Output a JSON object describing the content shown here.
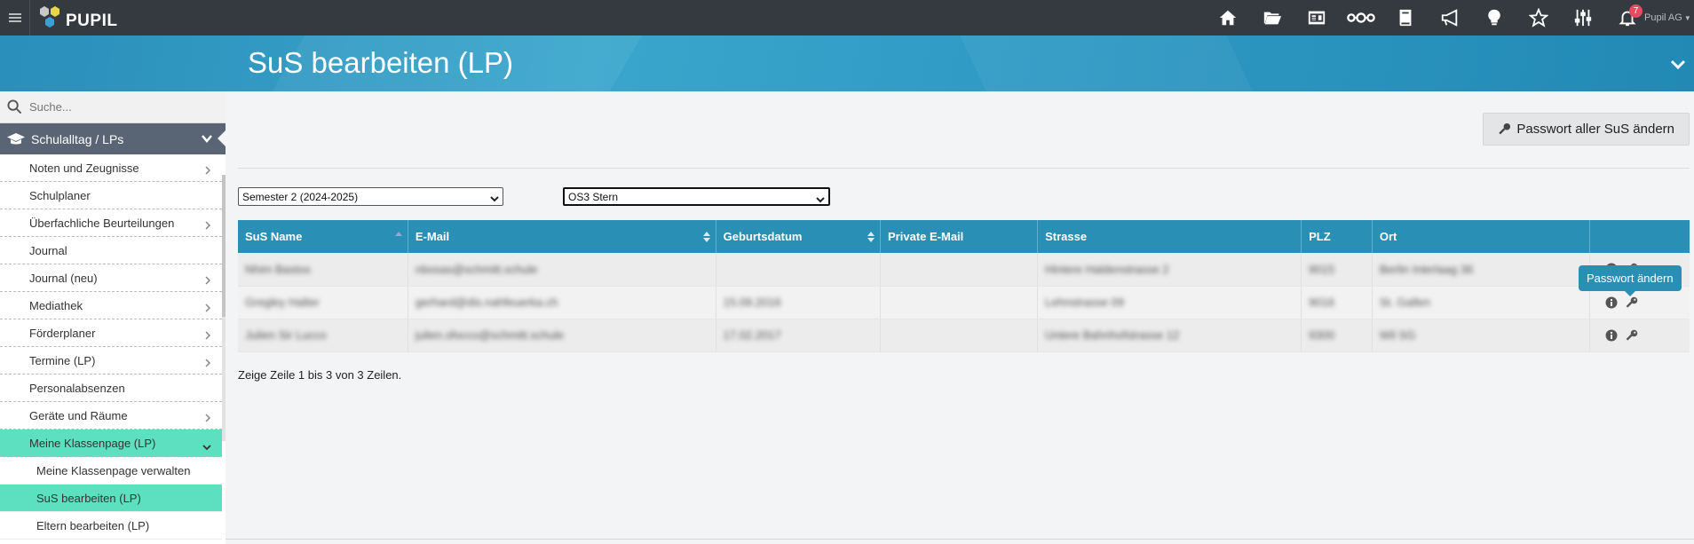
{
  "app": {
    "logo_text": "PUPIL",
    "user_name": "Pupil AG",
    "notification_count": "7",
    "top_icons": [
      "home-icon",
      "folder-icon",
      "id-card-icon",
      "network-icon",
      "book-icon",
      "megaphone-icon",
      "lightbulb-icon",
      "star-icon",
      "sliders-icon",
      "bell-icon"
    ]
  },
  "banner": {
    "title": "SuS bearbeiten (LP)"
  },
  "sidebar": {
    "search_placeholder": "Suche...",
    "section": "Schulalltag / LPs",
    "items": [
      {
        "label": "Noten und Zeugnisse",
        "has_children": true
      },
      {
        "label": "Schulplaner",
        "has_children": false
      },
      {
        "label": "Überfachliche Beurteilungen",
        "has_children": true
      },
      {
        "label": "Journal",
        "has_children": false
      },
      {
        "label": "Journal (neu)",
        "has_children": true
      },
      {
        "label": "Mediathek",
        "has_children": true
      },
      {
        "label": "Förderplaner",
        "has_children": true
      },
      {
        "label": "Termine (LP)",
        "has_children": true
      },
      {
        "label": "Personalabsenzen",
        "has_children": false
      },
      {
        "label": "Geräte und Räume",
        "has_children": true
      }
    ],
    "active_parent": "Meine Klassenpage (LP)",
    "sub_items": [
      {
        "label": "Meine Klassenpage verwalten"
      },
      {
        "label": "SuS bearbeiten (LP)",
        "active": true
      },
      {
        "label": "Eltern bearbeiten (LP)"
      }
    ]
  },
  "main": {
    "password_all_button": "Passwort aller SuS ändern",
    "semester_select": "Semester 2 (2024-2025)",
    "class_select": "OS3 Stern",
    "table": {
      "headers": [
        "SuS Name",
        "E-Mail",
        "Geburtsdatum",
        "Private E-Mail",
        "Strasse",
        "PLZ",
        "Ort",
        ""
      ],
      "rows": [
        [
          "Nhim Bastos",
          "nbosas@schmitt.schule",
          "",
          "",
          "Hintere Haldenstrasse 2",
          "9015",
          "Berlin Interlaag 36",
          ""
        ],
        [
          "Gregley Halter",
          "gerhard@dis.nahfeuerka.ch",
          "15.09.2016",
          "",
          "Lehnstrasse 09",
          "9016",
          "St. Gallen",
          ""
        ],
        [
          "Julien Sir Lucco",
          "julien.sfocco@schmitt.schule",
          "17.02.2017",
          "",
          "Untere Bahnhofstrasse 12",
          "9300",
          "Wil SG",
          ""
        ]
      ]
    },
    "tooltip": "Passwort ändern",
    "footer": "Zeige Zeile 1 bis 3 von 3 Zeilen."
  }
}
